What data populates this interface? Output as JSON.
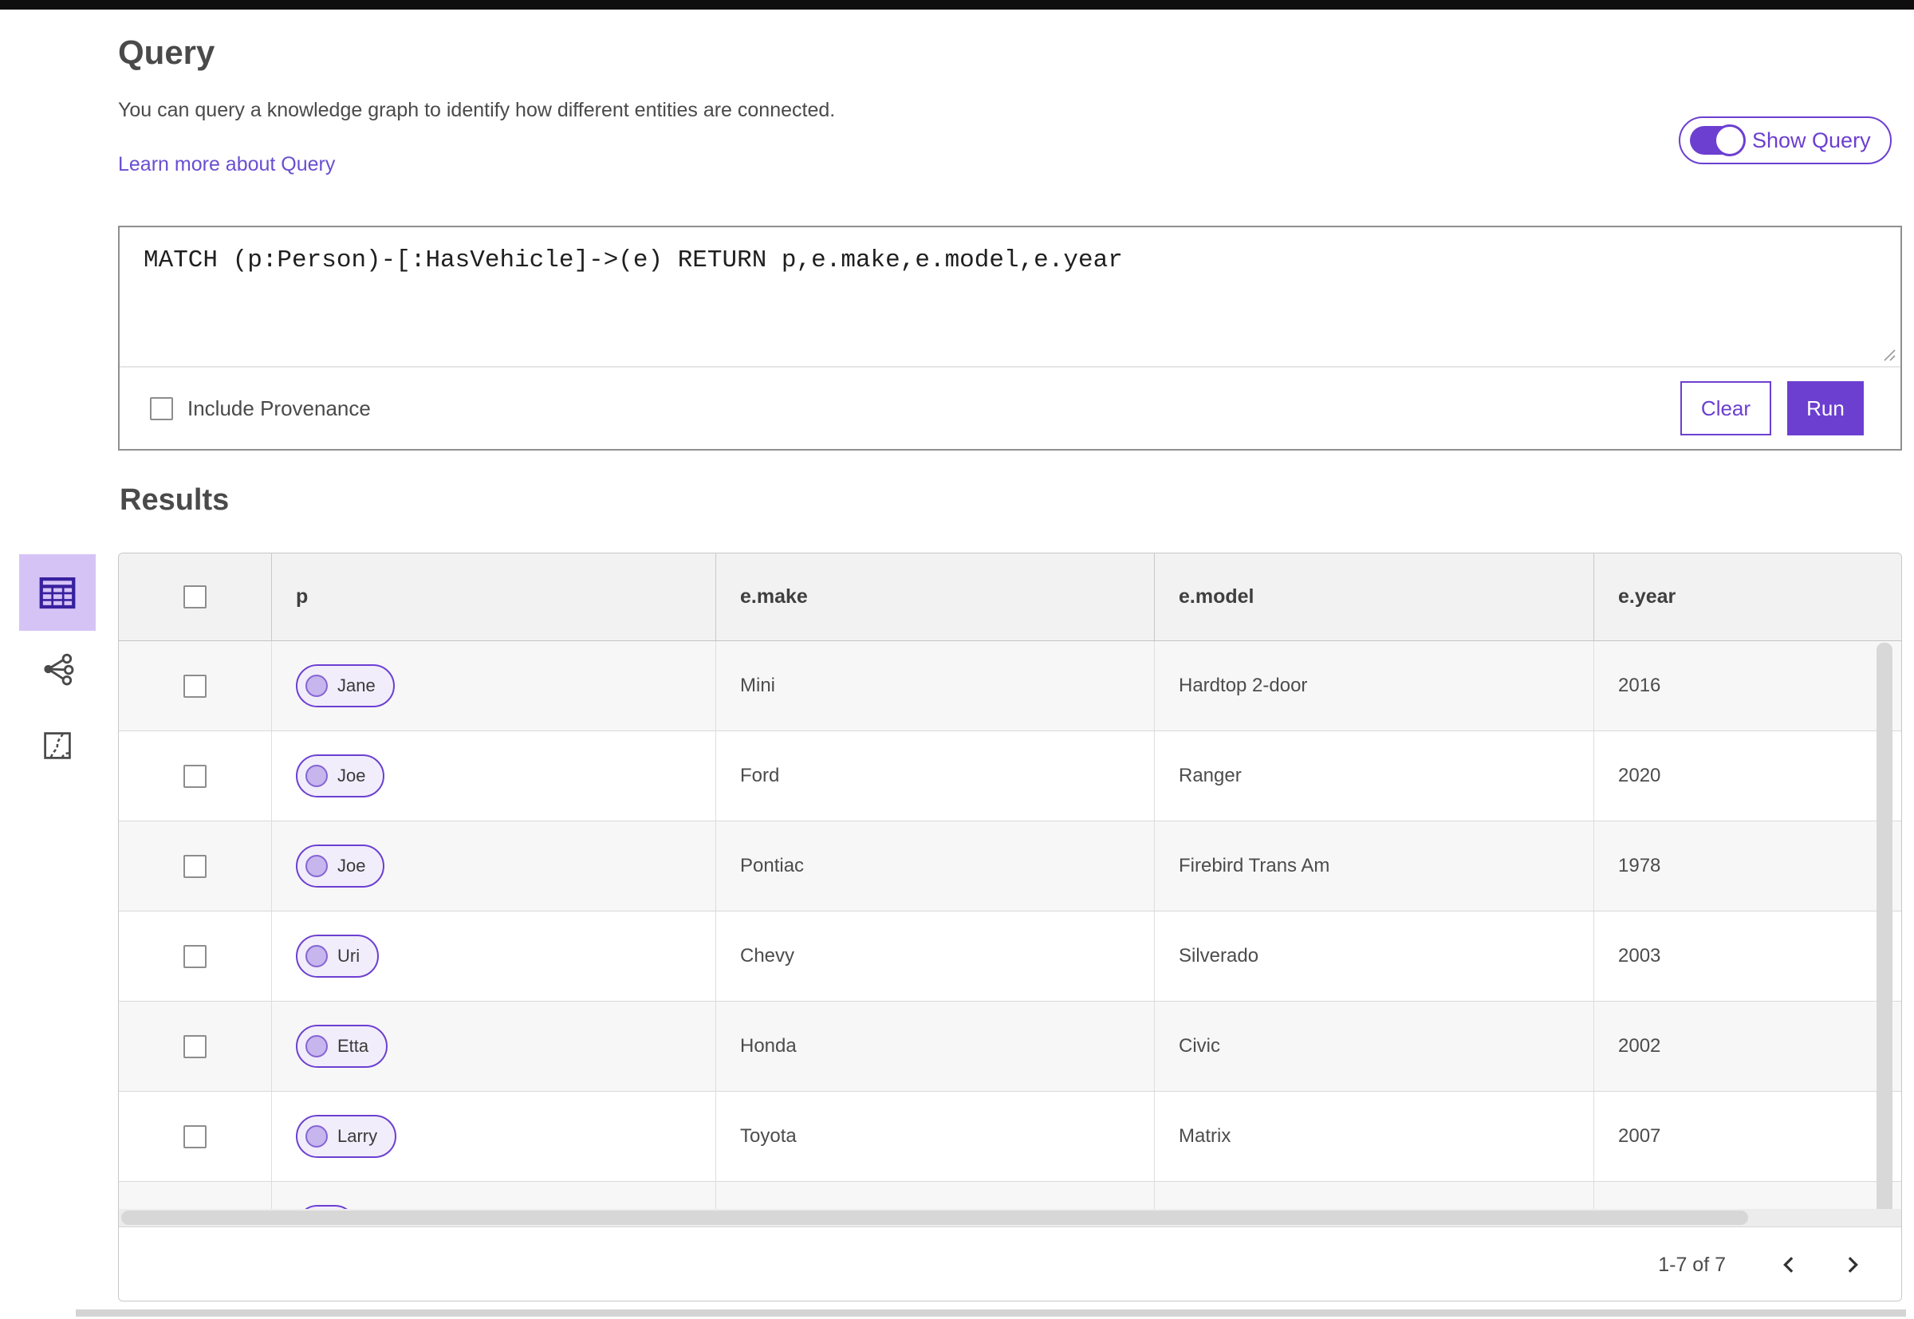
{
  "colors": {
    "accent": "#6c3fd1",
    "icon_purple": "#38219e",
    "selected_tile_bg": "#d6c3f6",
    "pill_bg": "#f1edfb",
    "pill_node_fill": "#c7b5ee",
    "pill_node_border": "#8565d2",
    "table_header_bg": "#f2f2f2",
    "row_alt_bg": "#f7f7f7"
  },
  "query": {
    "title": "Query",
    "description": "You can query a knowledge graph to identify how different entities are connected.",
    "learn_more_label": "Learn more about Query",
    "show_query_label": "Show Query",
    "query_text": "MATCH (p:Person)-[:HasVehicle]->(e) RETURN p,e.make,e.model,e.year",
    "include_provenance_label": "Include Provenance",
    "clear_label": "Clear",
    "run_label": "Run"
  },
  "results": {
    "title": "Results",
    "views": [
      "table-view",
      "link-chart-view",
      "map-view"
    ],
    "table": {
      "columns": [
        "p",
        "e.make",
        "e.model",
        "e.year"
      ],
      "rows": [
        {
          "p": "Jane",
          "make": "Mini",
          "model": "Hardtop 2-door",
          "year": "2016"
        },
        {
          "p": "Joe",
          "make": "Ford",
          "model": "Ranger",
          "year": "2020"
        },
        {
          "p": "Joe",
          "make": "Pontiac",
          "model": "Firebird Trans Am",
          "year": "1978"
        },
        {
          "p": "Uri",
          "make": "Chevy",
          "model": "Silverado",
          "year": "2003"
        },
        {
          "p": "Etta",
          "make": "Honda",
          "model": "Civic",
          "year": "2002"
        },
        {
          "p": "Larry",
          "make": "Toyota",
          "model": "Matrix",
          "year": "2007"
        },
        {
          "p": "",
          "make": "",
          "model": "",
          "year": ""
        }
      ]
    },
    "pagination": {
      "range_label": "1-7 of 7"
    }
  }
}
